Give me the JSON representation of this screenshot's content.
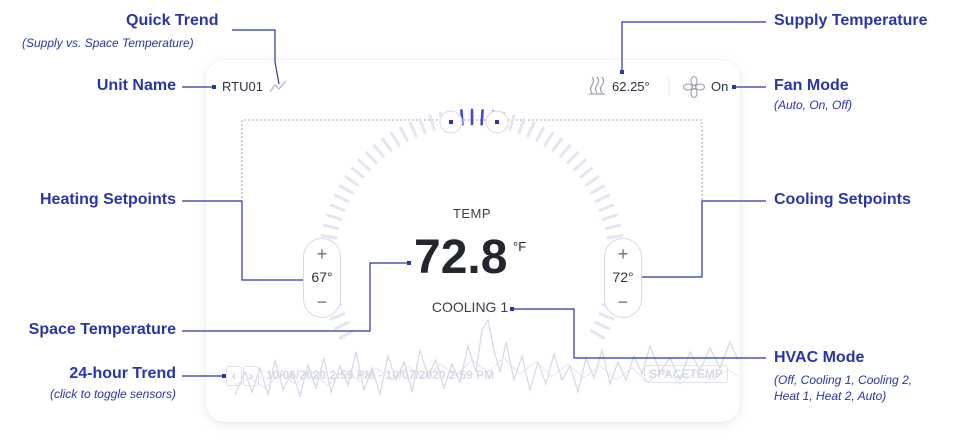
{
  "unit": {
    "name": "RTU01"
  },
  "supply": {
    "value": "62.25°"
  },
  "fan": {
    "mode": "On"
  },
  "thermostat": {
    "label": "TEMP",
    "space_temp": "72.8",
    "unit": "°F",
    "heating_setpoint": "67°",
    "cooling_setpoint": "72°",
    "hvac_mode": "COOLING 1",
    "plus": "+",
    "minus": "−"
  },
  "trend": {
    "date_range": "10/06/2020 2:59 PM - 10/07/2020 2:59 PM",
    "sensor_button": "SPACETEMP",
    "prev": "‹",
    "next": "›"
  },
  "callouts": {
    "quick_trend": {
      "title": "Quick Trend",
      "sub": "(Supply vs. Space Temperature)"
    },
    "unit_name": {
      "title": "Unit Name"
    },
    "heating_setpoints": {
      "title": "Heating Setpoints"
    },
    "space_temperature": {
      "title": "Space Temperature"
    },
    "trend_24h": {
      "title": "24-hour Trend",
      "sub": "(click to toggle sensors)"
    },
    "supply_temperature": {
      "title": "Supply Temperature"
    },
    "fan_mode": {
      "title": "Fan Mode",
      "sub": "(Auto, On, Off)"
    },
    "cooling_setpoints": {
      "title": "Cooling Setpoints"
    },
    "hvac_mode": {
      "title": "HVAC Mode",
      "sub1": "(Off, Cooling 1, Cooling 2,",
      "sub2": "Heat 1, Heat 2, Auto)"
    }
  },
  "colors": {
    "callout": "#2b34a8",
    "arc": "#e3e5f2",
    "arc_active": "#3d4bd6",
    "accent": "#f0b429"
  },
  "icons": {
    "quick_trend": "trend-line-icon",
    "supply": "heat-waves-icon",
    "fan": "fan-icon"
  }
}
